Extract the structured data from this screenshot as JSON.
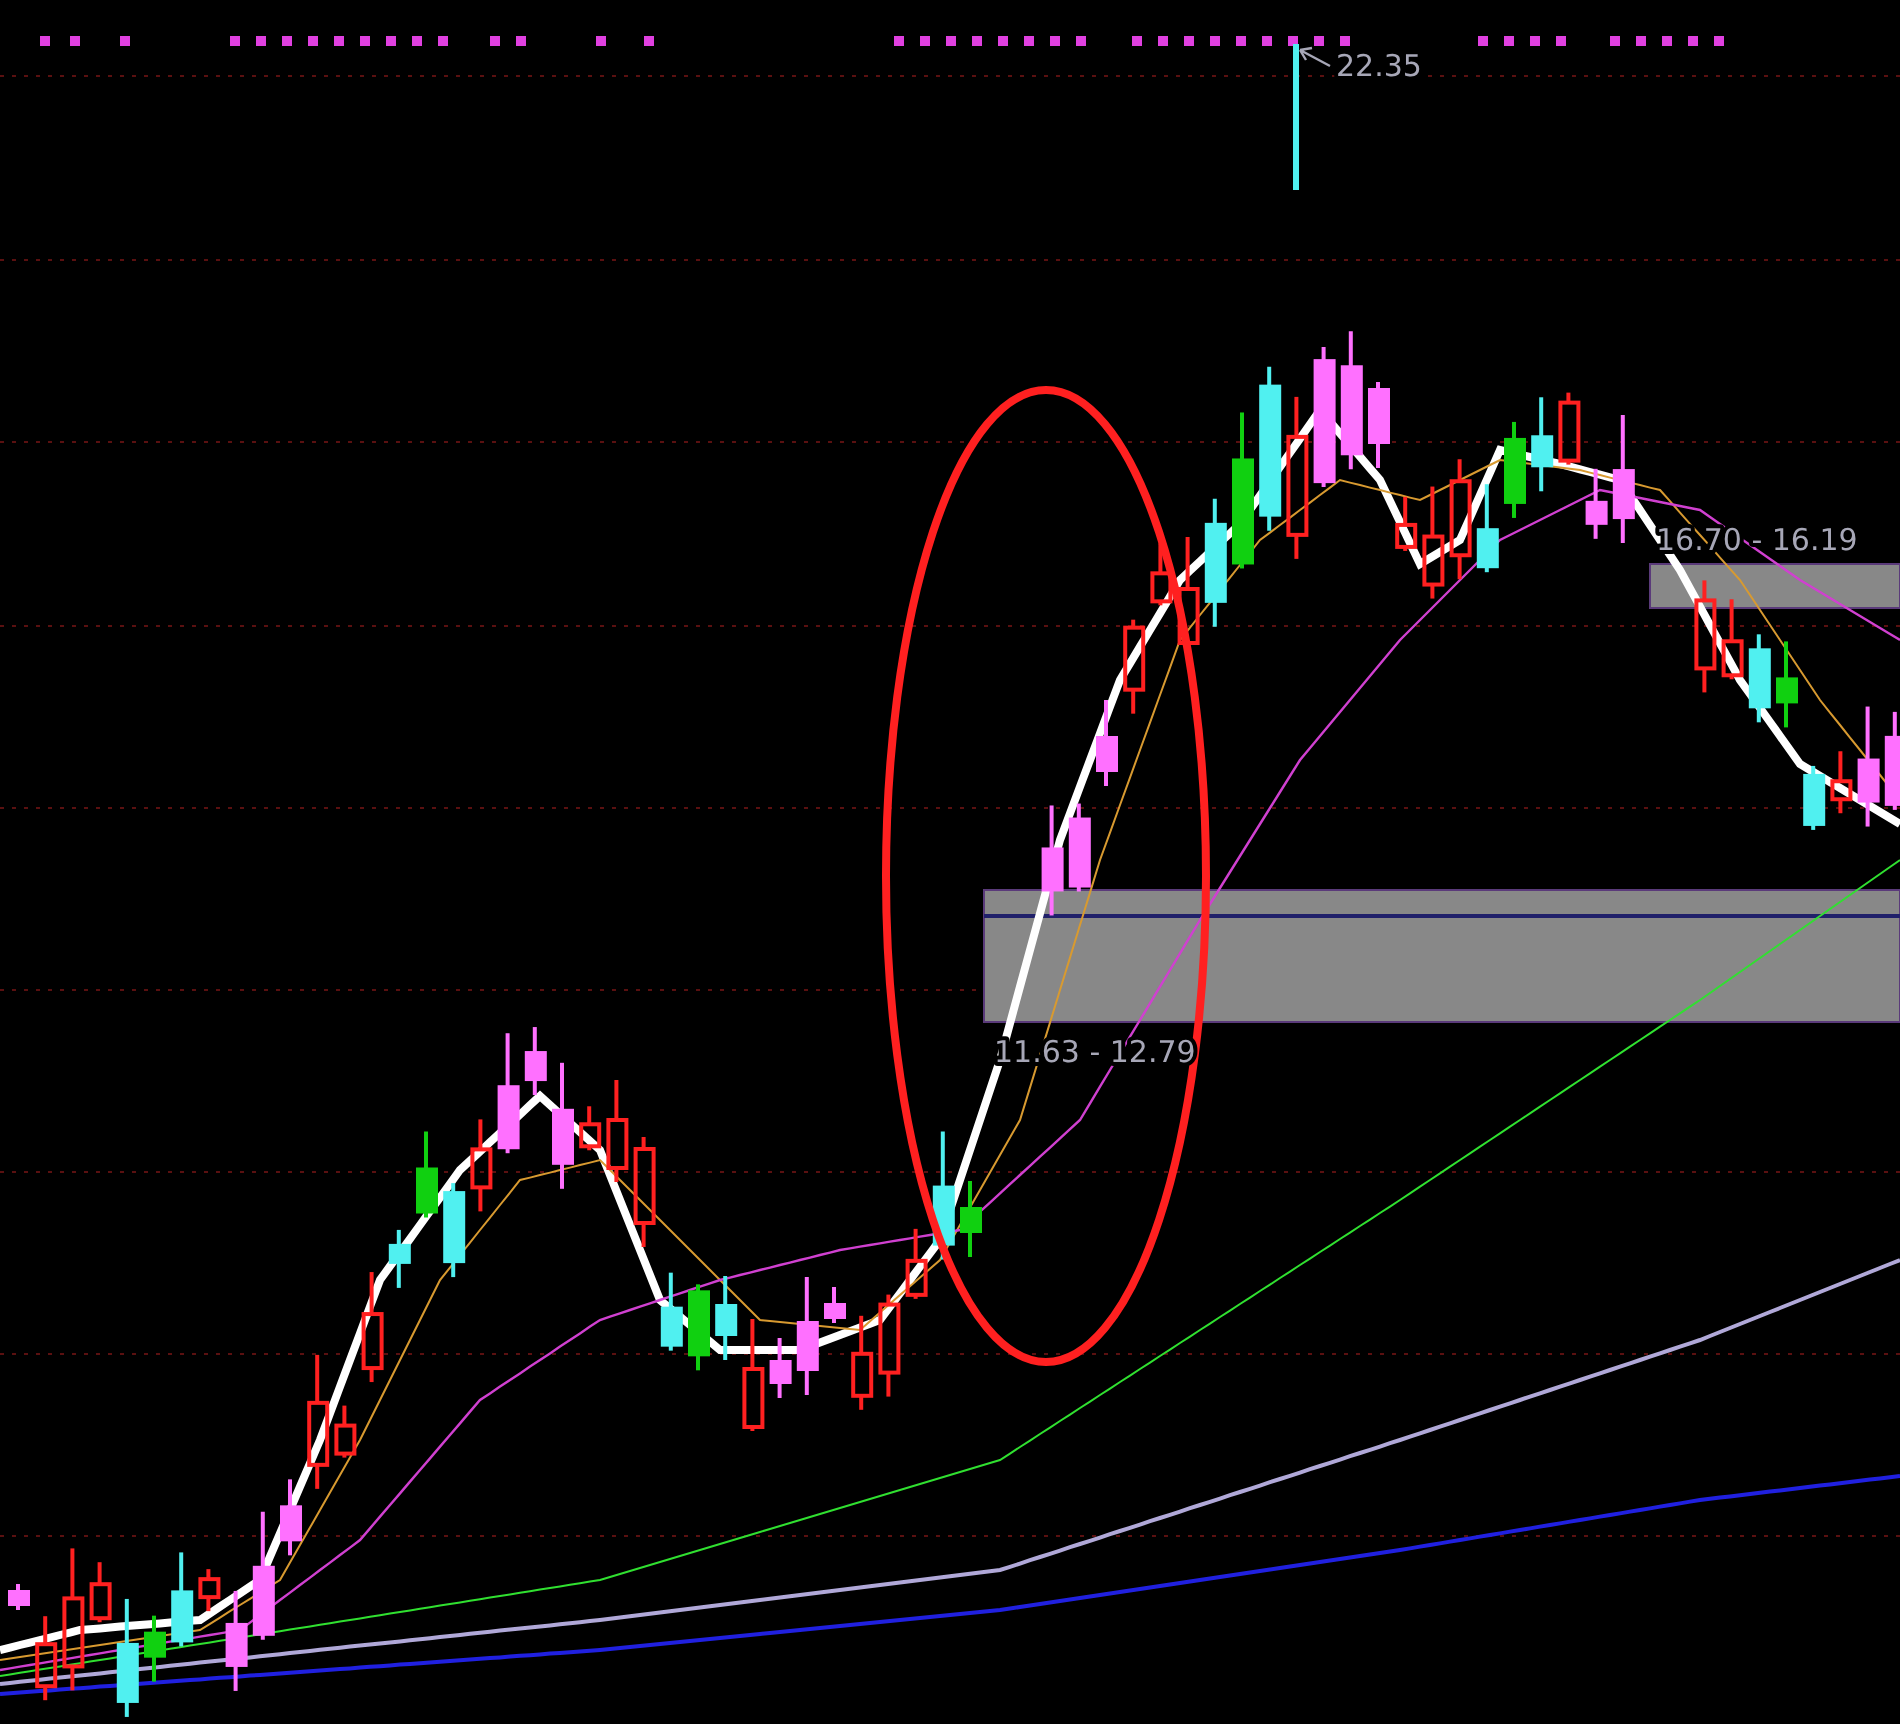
{
  "chart": {
    "labels": [
      {
        "kind": "peak",
        "text": "22.35"
      },
      {
        "kind": "zone",
        "text": "16.70 - 16.19"
      },
      {
        "kind": "zone",
        "text": "11.63 - 12.79"
      }
    ]
  }
}
